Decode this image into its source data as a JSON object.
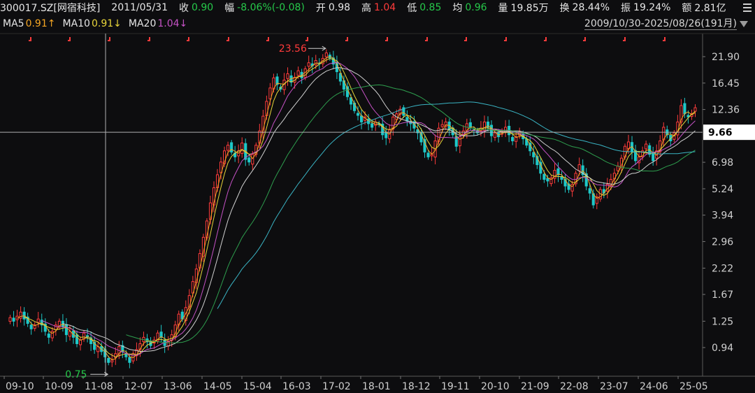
{
  "header": {
    "code": "300017.SZ[网宿科技]",
    "date": "2011/05/31",
    "close_label": "收",
    "close": "0.90",
    "change_label": "幅",
    "change": "-8.06%(-0.08)",
    "open_label": "开",
    "open": "0.98",
    "high_label": "高",
    "high": "1.04",
    "low_label": "低",
    "low": "0.85",
    "avg_label": "均",
    "avg": "0.96",
    "volume_label": "量",
    "volume": "19.85万",
    "turnover_label": "换",
    "turnover": "28.44%",
    "amplitude_label": "振",
    "amplitude": "19.24%",
    "amount_label": "额",
    "amount": "2.81亿",
    "menu_icon": "hamburger-icon"
  },
  "ma_bar": {
    "ma5_label": "MA5",
    "ma5_value": "0.91↑",
    "ma10_label": "MA10",
    "ma10_value": "0.91↓",
    "ma20_label": "MA20",
    "ma20_value": "1.04↓"
  },
  "range": {
    "text": "2009/10/30-2025/08/26(191月)",
    "dropdown_icon": "chevron-down-icon"
  },
  "colors": {
    "up": "#ff3b3b",
    "down": "#1ec8c8",
    "ma5": "#f5a623",
    "ma10": "#e8d53a",
    "ma20": "#c552c5",
    "ma30": "#d0d0d0",
    "ma60": "#2e9e4e",
    "ma120": "#3ab4c4",
    "crosshair": "#b0b0b0"
  },
  "chart_data": {
    "type": "candlestick",
    "y_scale": "log",
    "y_ticks": [
      "21.90",
      "16.45",
      "12.36",
      "9.66",
      "6.98",
      "5.24",
      "3.94",
      "2.96",
      "2.22",
      "1.67",
      "1.25",
      "0.94"
    ],
    "x_ticks": [
      "09-10",
      "10-09",
      "11-08",
      "12-07",
      "13-06",
      "14-05",
      "15-04",
      "16-03",
      "17-02",
      "18-01",
      "18-12",
      "19-11",
      "20-10",
      "21-09",
      "22-08",
      "23-07",
      "24-06",
      "25-05"
    ],
    "crosshair_price": "9.66",
    "max_annotation": "23.56",
    "min_annotation": "0.75",
    "close": [
      1.3,
      1.25,
      1.32,
      1.38,
      1.28,
      1.22,
      1.15,
      1.2,
      1.28,
      1.2,
      1.12,
      1.05,
      1.12,
      1.2,
      1.25,
      1.18,
      1.08,
      1.12,
      1.05,
      0.98,
      1.02,
      1.1,
      1.05,
      0.98,
      0.92,
      0.95,
      0.9,
      0.85,
      0.8,
      0.82,
      0.88,
      0.95,
      0.9,
      0.85,
      0.8,
      0.88,
      0.92,
      0.98,
      1.05,
      1.0,
      0.96,
      1.02,
      1.1,
      1.05,
      0.96,
      1.0,
      1.08,
      1.2,
      1.35,
      1.28,
      1.45,
      1.65,
      1.92,
      2.2,
      2.6,
      3.1,
      3.7,
      4.5,
      5.3,
      6.1,
      7.0,
      7.9,
      8.4,
      7.8,
      7.4,
      7.9,
      8.6,
      7.2,
      7.0,
      7.6,
      8.4,
      9.8,
      11.5,
      13.5,
      15.6,
      17.4,
      16.2,
      15.4,
      17.0,
      18.2,
      16.6,
      17.5,
      18.8,
      17.4,
      19.2,
      20.5,
      19.8,
      21.0,
      20.4,
      21.5,
      22.8,
      21.6,
      20.2,
      18.6,
      16.8,
      15.4,
      14.2,
      13.1,
      12.2,
      11.6,
      10.8,
      11.4,
      10.6,
      10.2,
      10.8,
      10.5,
      9.4,
      9.1,
      9.9,
      11.4,
      11.8,
      12.4,
      11.6,
      10.9,
      10.6,
      10.1,
      9.6,
      8.7,
      7.8,
      7.4,
      7.6,
      8.8,
      10.1,
      10.5,
      10.8,
      9.9,
      9.4,
      8.3,
      9.2,
      9.8,
      10.6,
      10.2,
      9.9,
      9.6,
      10.1,
      10.8,
      10.2,
      9.3,
      9.6,
      9.2,
      9.8,
      10.2,
      9.4,
      8.8,
      9.2,
      9.7,
      9.0,
      8.4,
      7.9,
      7.4,
      6.8,
      6.2,
      5.8,
      5.7,
      5.9,
      6.4,
      6.1,
      5.8,
      5.4,
      5.2,
      5.5,
      6.2,
      6.8,
      6.1,
      5.4,
      5.0,
      4.4,
      4.8,
      5.2,
      5.0,
      5.5,
      5.8,
      6.2,
      6.7,
      7.3,
      8.3,
      8.7,
      7.8,
      7.1,
      7.4,
      7.9,
      8.5,
      7.6,
      7.1,
      7.9,
      8.8,
      10.2,
      9.4,
      8.8,
      9.6,
      10.8,
      12.9,
      11.8,
      11.4,
      11.8,
      12.6
    ],
    "ma_series": [
      "MA5",
      "MA10",
      "MA20",
      "MA30",
      "MA60",
      "MA120"
    ]
  }
}
